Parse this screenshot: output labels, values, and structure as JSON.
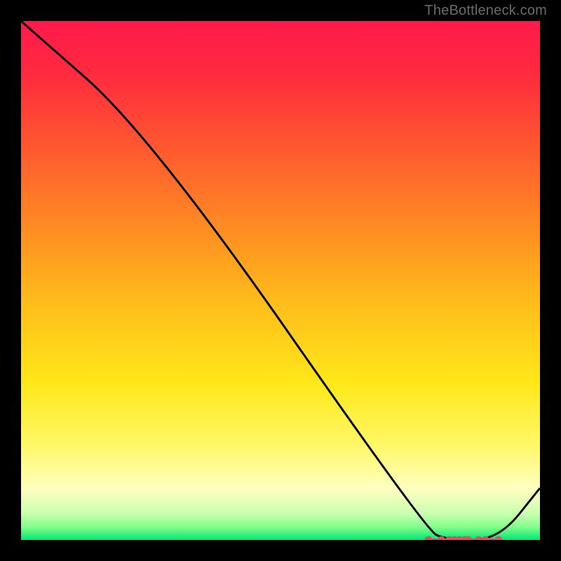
{
  "watermark": "TheBottleneck.com",
  "chart_data": {
    "type": "line",
    "title": "",
    "xlabel": "",
    "ylabel": "",
    "xlim": [
      0,
      100
    ],
    "ylim": [
      0,
      100
    ],
    "x": [
      0,
      25,
      78,
      82,
      92,
      100
    ],
    "y": [
      100,
      78,
      2,
      0,
      0,
      10
    ],
    "optimal_zone_x": [
      78,
      92
    ],
    "gradient_stops": [
      {
        "offset": 0.0,
        "color": "#ff1a4b"
      },
      {
        "offset": 0.1,
        "color": "#ff2a3f"
      },
      {
        "offset": 0.25,
        "color": "#ff5a2f"
      },
      {
        "offset": 0.4,
        "color": "#ff8c22"
      },
      {
        "offset": 0.55,
        "color": "#ffbf1a"
      },
      {
        "offset": 0.7,
        "color": "#ffe81a"
      },
      {
        "offset": 0.82,
        "color": "#fff86a"
      },
      {
        "offset": 0.9,
        "color": "#ffffc0"
      },
      {
        "offset": 0.95,
        "color": "#c8ffb0"
      },
      {
        "offset": 0.975,
        "color": "#7fff8a"
      },
      {
        "offset": 1.0,
        "color": "#00e676"
      }
    ],
    "marker_positions_x": [
      78.5,
      81,
      82.5,
      83.5,
      84.5,
      85.5,
      86.2,
      88.2,
      89.5,
      92
    ],
    "marker_color": "#e84a5f",
    "line_color": "#000000"
  }
}
